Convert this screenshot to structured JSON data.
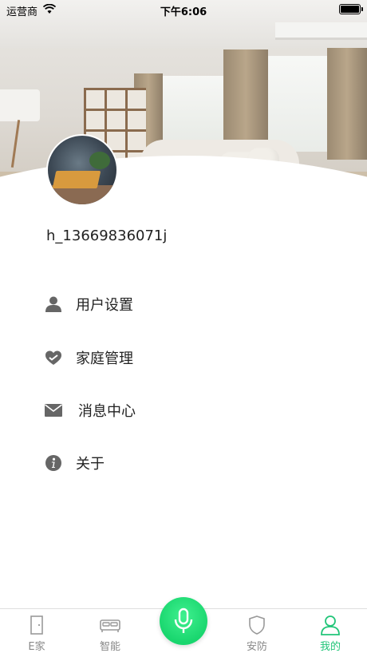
{
  "status_bar": {
    "carrier": "运营商",
    "time": "下午6:06"
  },
  "profile": {
    "username": "h_13669836071j"
  },
  "menu": {
    "items": [
      {
        "label": "用户设置",
        "icon": "user-icon"
      },
      {
        "label": "家庭管理",
        "icon": "heart-hands-icon"
      },
      {
        "label": "消息中心",
        "icon": "envelope-icon"
      },
      {
        "label": "关于",
        "icon": "info-icon"
      }
    ]
  },
  "tabbar": {
    "tabs": [
      {
        "label": "E家",
        "icon": "door-icon"
      },
      {
        "label": "智能",
        "icon": "bed-icon"
      },
      {
        "label": "安防",
        "icon": "shield-icon"
      },
      {
        "label": "我的",
        "icon": "person-icon",
        "active": true
      }
    ],
    "voice_button_icon": "microphone-icon"
  },
  "colors": {
    "accent": "#22c579",
    "mic_button": "#1fdc74",
    "icon_gray": "#555555",
    "tab_gray": "#888888"
  }
}
